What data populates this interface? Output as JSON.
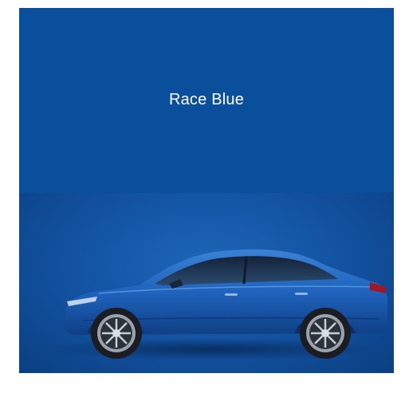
{
  "swatch": {
    "color_name": "Race Blue",
    "color_hex": "#0a4f9c"
  },
  "preview": {
    "background_hex": "#1455a5",
    "car_body_hex": "#1f63bd",
    "icon": "car-side-icon"
  }
}
